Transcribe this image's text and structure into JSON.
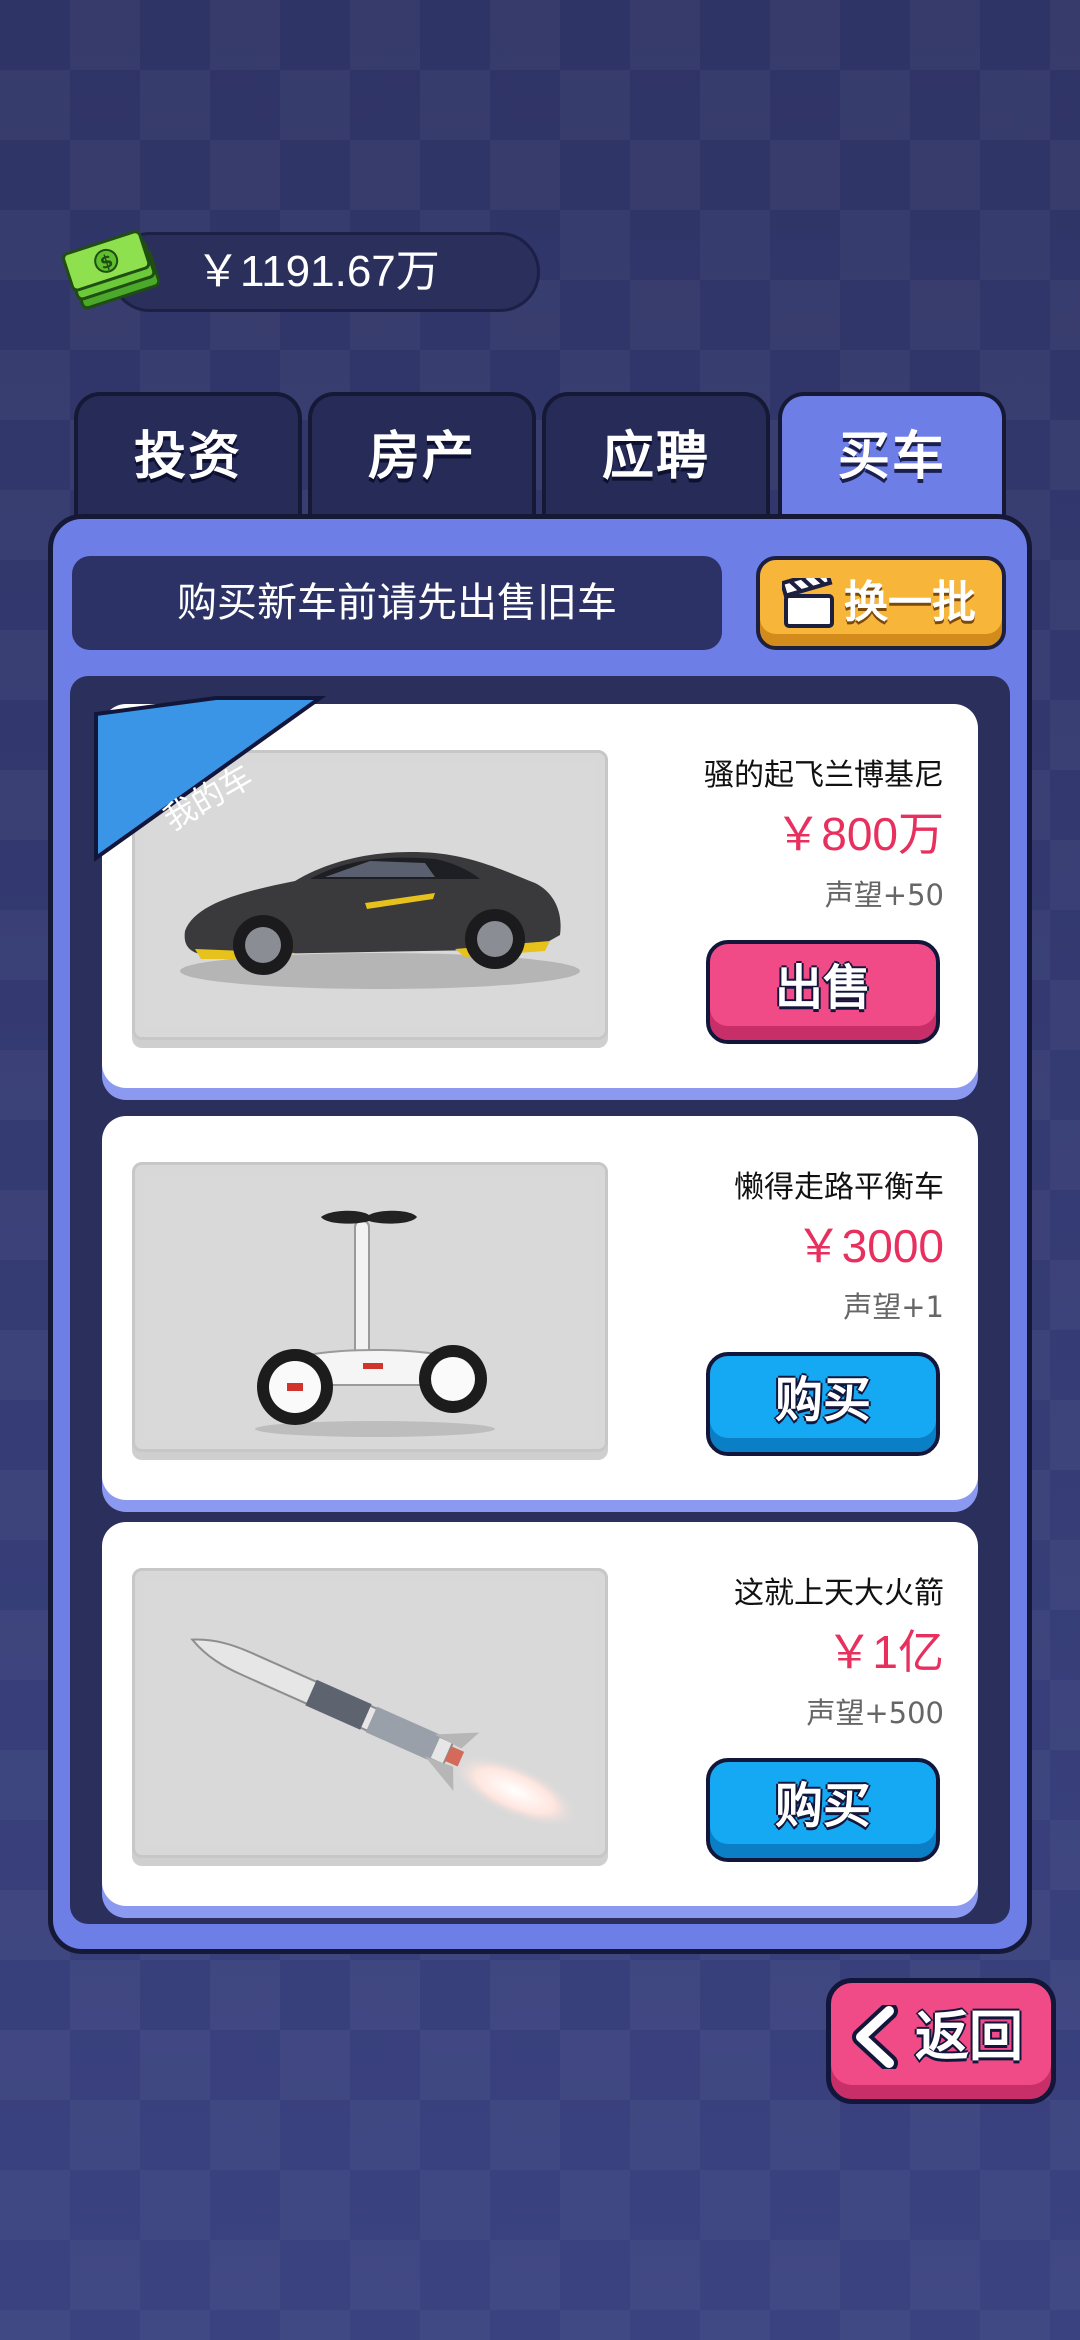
{
  "balance": "￥1191.67万",
  "tabs": [
    {
      "label": "投资",
      "active": false
    },
    {
      "label": "房产",
      "active": false
    },
    {
      "label": "应聘",
      "active": false
    },
    {
      "label": "买车",
      "active": true
    }
  ],
  "notice": "购买新车前请先出售旧车",
  "refresh_label": "换一批",
  "my_car_label": "我的车",
  "cars": [
    {
      "name": "骚的起飞兰博基尼",
      "price": "￥800万",
      "fame": "声望+50",
      "action": "出售",
      "image": "sports-car",
      "owned": true
    },
    {
      "name": "懒得走路平衡车",
      "price": "￥3000",
      "fame": "声望+1",
      "action": "购买",
      "image": "balance-scooter",
      "owned": false
    },
    {
      "name": "这就上天大火箭",
      "price": "￥1亿",
      "fame": "声望+500",
      "action": "购买",
      "image": "rocket",
      "owned": false
    }
  ],
  "back_label": "返回",
  "colors": {
    "accent_pink": "#f04a87",
    "accent_blue": "#16a9f3",
    "accent_yellow": "#f7b53a",
    "panel": "#6d7fe6",
    "price_red": "#e8305e"
  }
}
